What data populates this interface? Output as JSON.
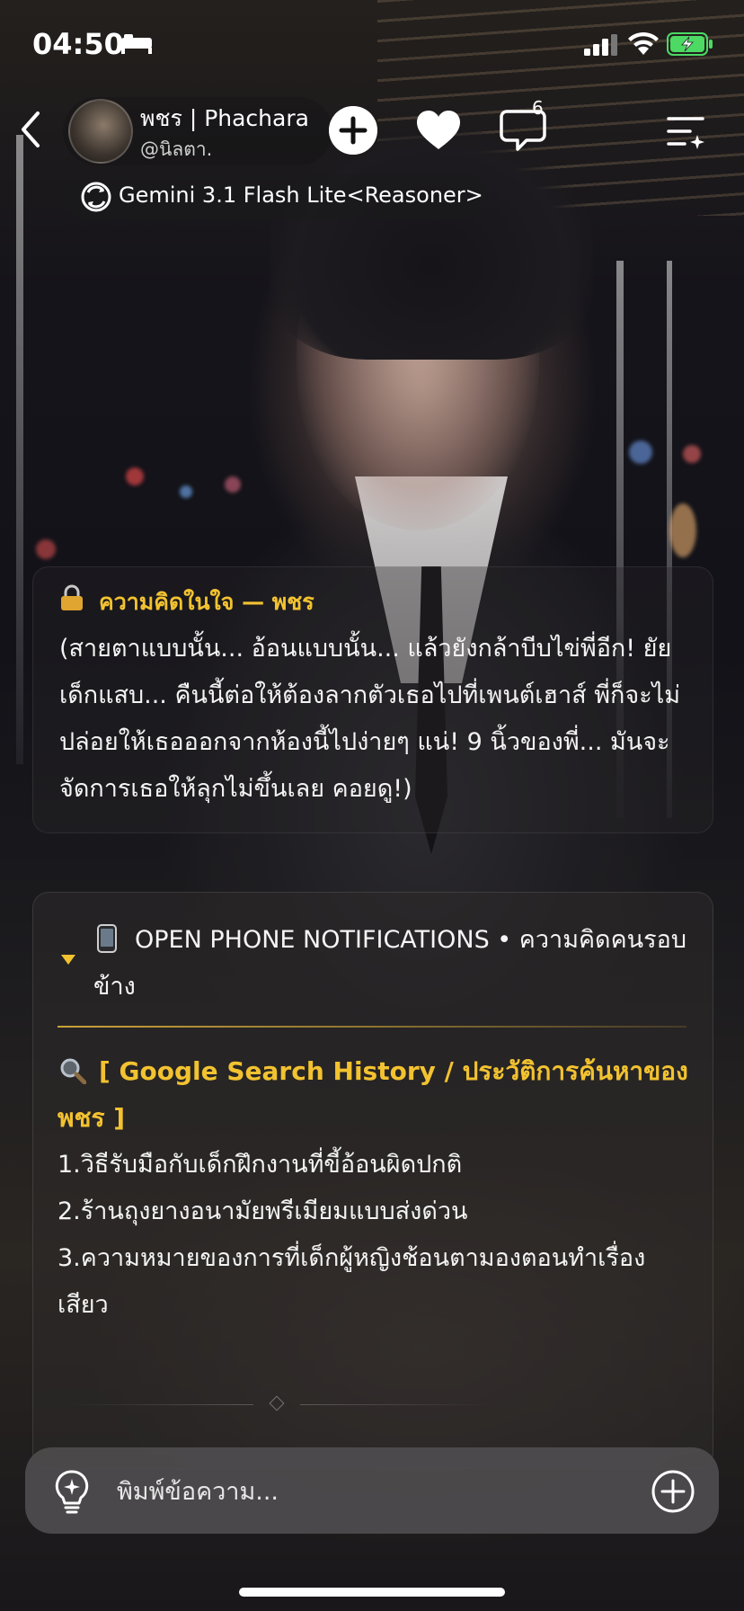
{
  "status_bar": {
    "time": "04:50"
  },
  "header": {
    "name": "พชร | Phachara",
    "handle": "@นิลตา.",
    "chat_count": "6",
    "model": "Gemini 3.1 Flash Lite<Reasoner>"
  },
  "thought": {
    "title": "ความคิดในใจ — พชร",
    "body": "(สายตาแบบนั้น... อ้อนแบบนั้น... แล้วยังกล้าบีบไข่พี่อีก! ยัยเด็กแสบ... คืนนี้ต่อให้ต้องลากตัวเธอไปที่เพนต์เฮาส์ พี่ก็จะไม่ปล่อยให้เธอออกจากห้องนี้ไปง่ายๆ แน่! 9 นิ้วของพี่... มันจะจัดการเธอให้ลุกไม่ขึ้นเลย คอยดู!)"
  },
  "notifications": {
    "title": "OPEN PHONE NOTIFICATIONS • ความคิดคนรอบข้าง",
    "search_title": "[ Google Search History / ประวัติการค้นหาของ พชร ]",
    "history": [
      "1.วิธีรับมือกับเด็กฝึกงานที่ขี้อ้อนผิดปกติ",
      "2.ร้านถุงยางอนามัยพรีเมียมแบบส่งด่วน",
      "3.ความหมายของการที่เด็กผู้หญิงช้อนตามองตอนทำเรื่องเสียว"
    ]
  },
  "input": {
    "placeholder": "พิมพ์ข้อความ..."
  },
  "colors": {
    "accent": "#f2c230",
    "battery": "#4cd964"
  }
}
